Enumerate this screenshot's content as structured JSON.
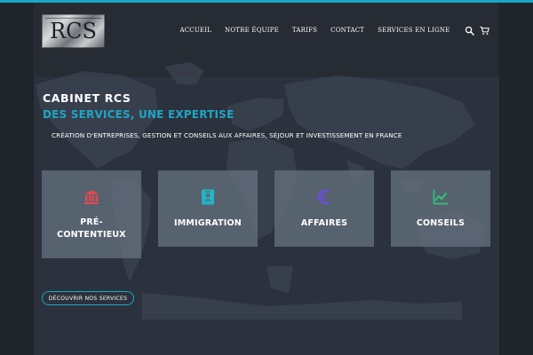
{
  "brand": {
    "logo_text": "RCS",
    "accent_color": "#19a7c7"
  },
  "nav": {
    "items": [
      {
        "label": "ACCUEIL"
      },
      {
        "label": "NOTRE ÉQUIPE"
      },
      {
        "label": "TARIFS"
      },
      {
        "label": "CONTACT"
      },
      {
        "label": "SERVICES EN LIGNE"
      }
    ],
    "icons": [
      "search-icon",
      "shopping-cart-icon"
    ]
  },
  "hero": {
    "title": "CABINET RCS",
    "subtitle": "DES SERVICES, UNE EXPERTISE",
    "tagline": "CRÉATION D'ENTREPRISES, GESTION ET CONSEILS AUX AFFAIRES,  SÉJOUR ET INVESTISSEMENT EN FRANCE",
    "cta_label": "DÉCOUVRIR NOS SERVICES"
  },
  "cards": [
    {
      "label": "PRÉ-CONTENTIEUX",
      "line1": "PRÉ-",
      "line2": "CONTENTIEUX",
      "icon": "bank-icon",
      "icon_color": "#e5484d"
    },
    {
      "label": "IMMIGRATION",
      "icon": "passport-icon",
      "icon_color": "#1fb6c9"
    },
    {
      "label": "AFFAIRES",
      "icon": "euro-icon",
      "icon_color": "#6a4fd8"
    },
    {
      "label": "CONSEILS",
      "icon": "chart-line-icon",
      "icon_color": "#2ec27e"
    }
  ]
}
